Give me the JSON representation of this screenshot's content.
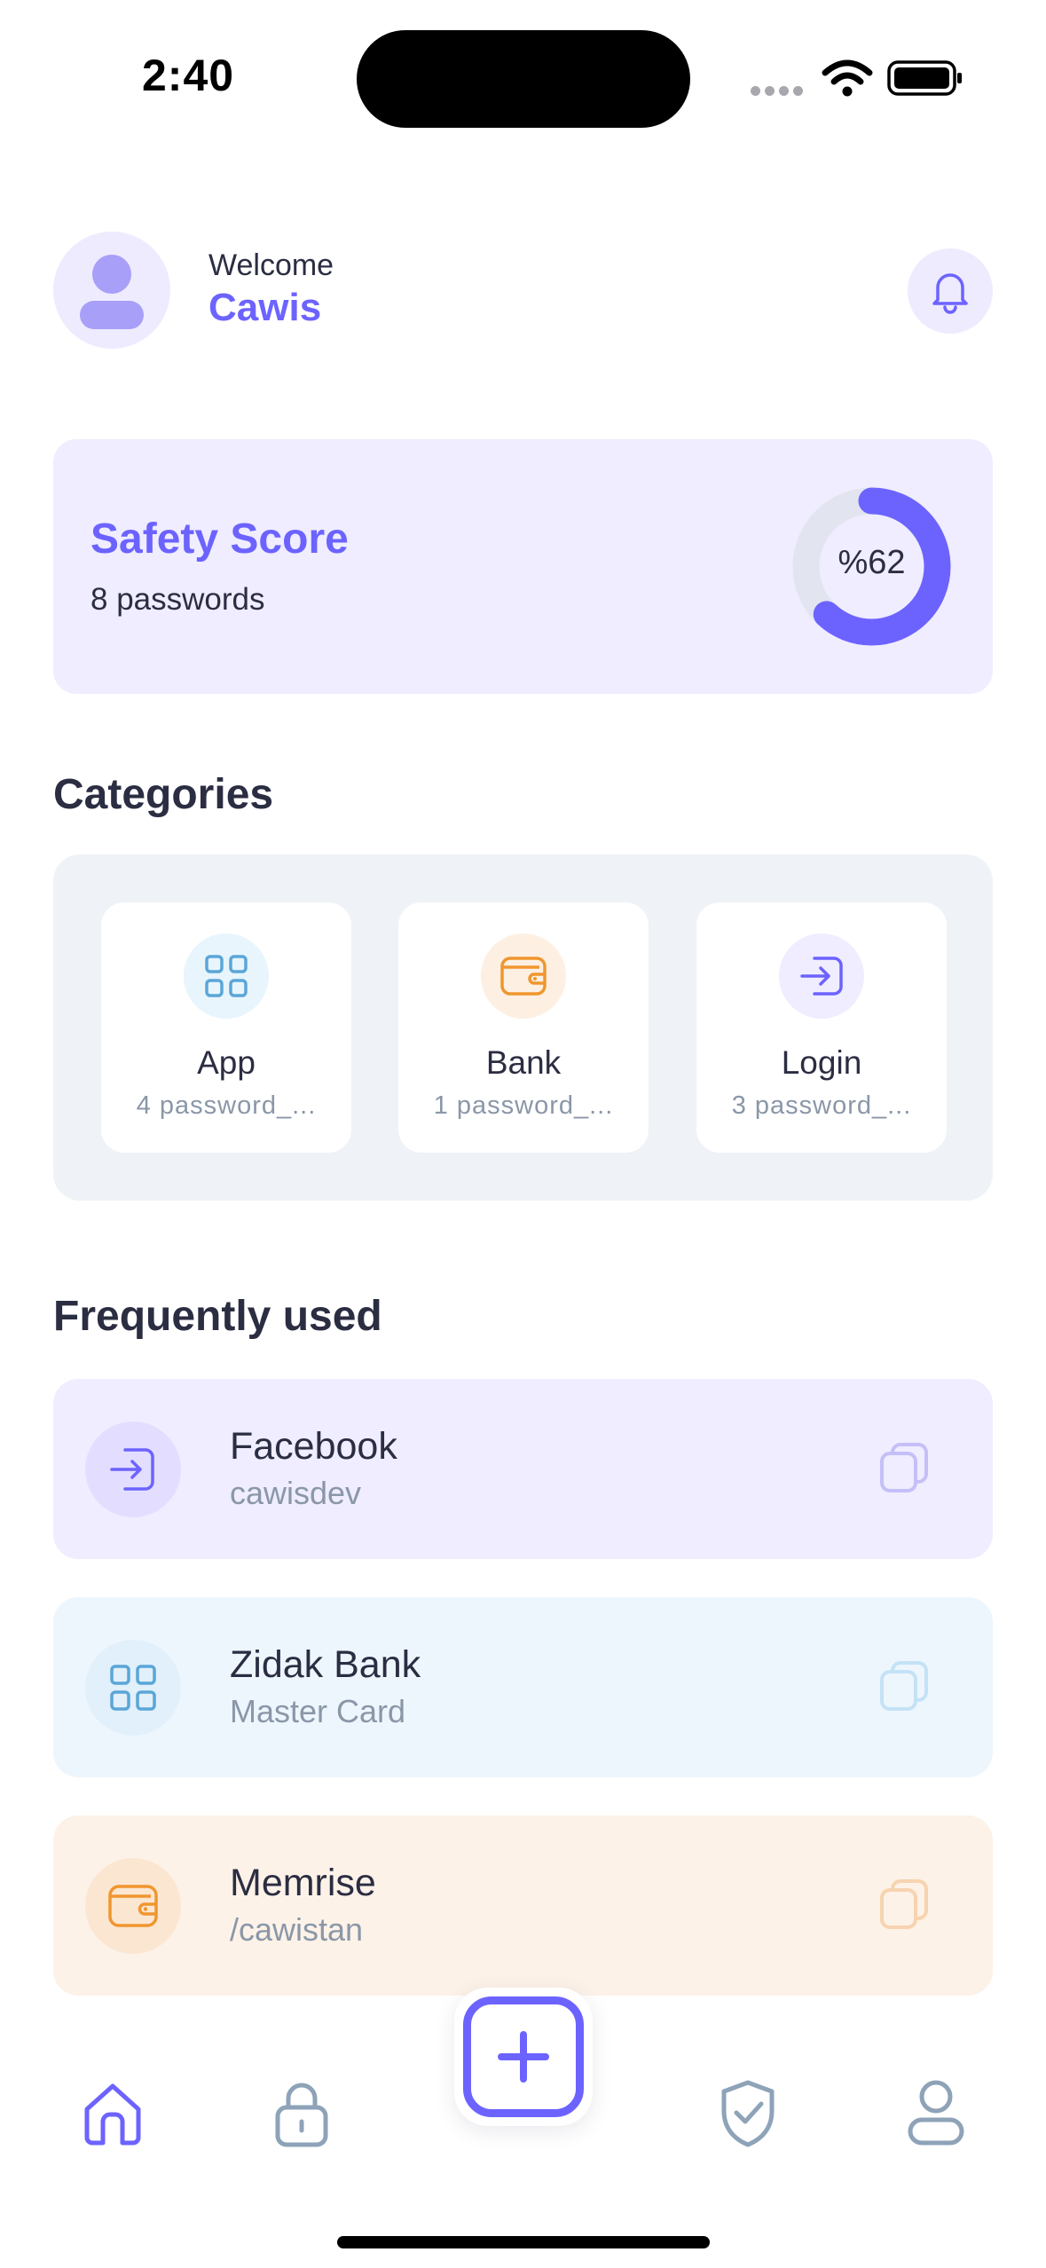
{
  "status_bar": {
    "time": "2:40"
  },
  "header": {
    "welcome": "Welcome",
    "username": "Cawis"
  },
  "safety": {
    "title": "Safety Score",
    "subtitle": "8 passwords",
    "score_label": "%62",
    "score_fraction": 0.62
  },
  "categories": {
    "title": "Categories",
    "items": [
      {
        "name": "App",
        "count": "4 password_...",
        "icon": "grid-icon"
      },
      {
        "name": "Bank",
        "count": "1 password_...",
        "icon": "wallet-icon"
      },
      {
        "name": "Login",
        "count": "3 password_...",
        "icon": "login-icon"
      }
    ]
  },
  "frequent": {
    "title": "Frequently used",
    "items": [
      {
        "name": "Facebook",
        "sub": "cawisdev",
        "icon": "login-icon"
      },
      {
        "name": "Zidak Bank",
        "sub": "Master Card",
        "icon": "grid-icon"
      },
      {
        "name": "Memrise",
        "sub": "/cawistan",
        "icon": "wallet-icon"
      }
    ]
  },
  "colors": {
    "accent": "#6c63ff",
    "lavender_bg": "#efedff",
    "blue_bg": "#eef6fd",
    "orange_bg": "#fdf2e8",
    "blue_icon": "#5aa6d8",
    "orange_icon": "#f0962e",
    "muted": "#8a97a8"
  },
  "nav": {
    "items": [
      "home-icon",
      "lock-icon",
      "add-icon",
      "shield-icon",
      "profile-icon"
    ]
  }
}
